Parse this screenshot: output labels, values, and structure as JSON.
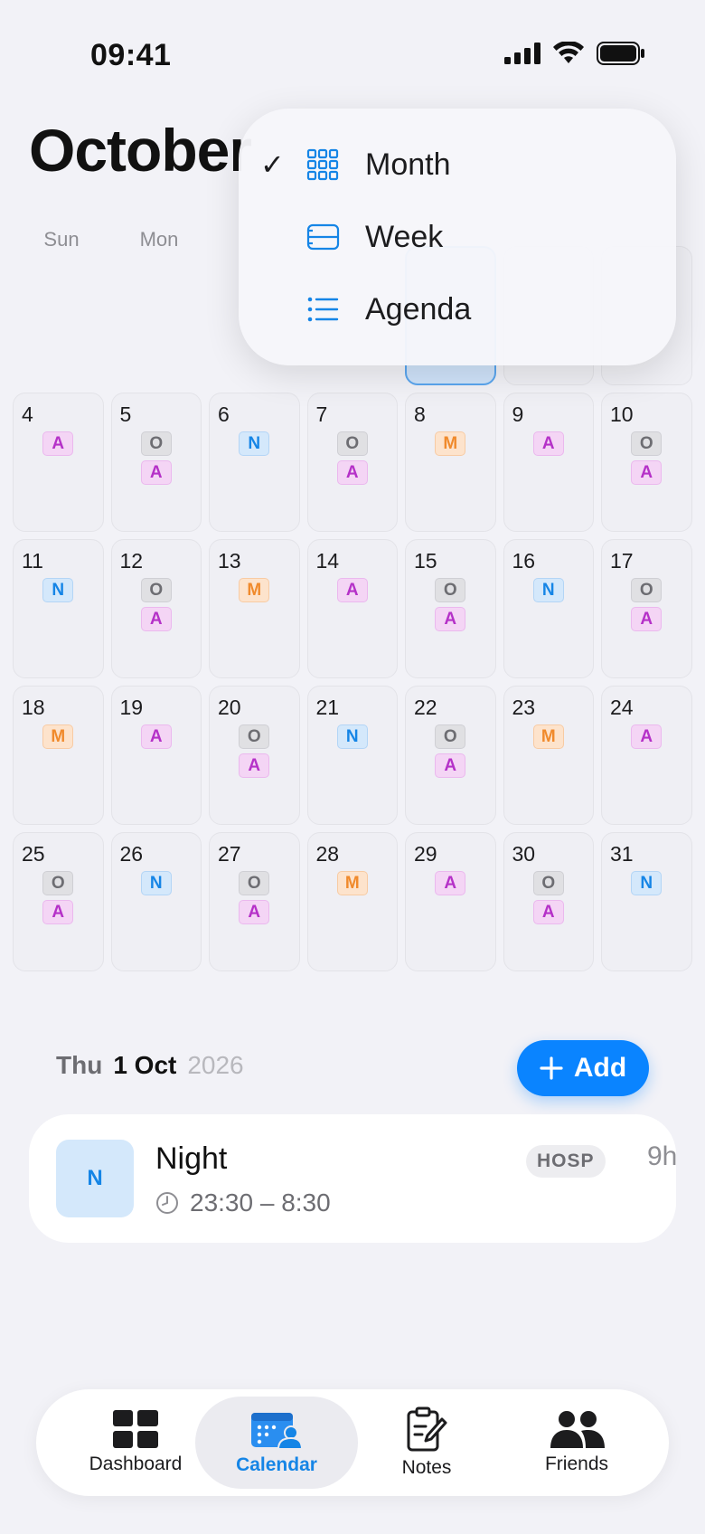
{
  "status": {
    "time": "09:41"
  },
  "header": {
    "title": "October"
  },
  "weekdays": [
    "Sun",
    "Mon"
  ],
  "menu": {
    "items": [
      {
        "label": "Month",
        "checked": true,
        "icon": "grid-icon"
      },
      {
        "label": "Week",
        "checked": false,
        "icon": "week-icon"
      },
      {
        "label": "Agenda",
        "checked": false,
        "icon": "list-icon"
      }
    ],
    "check": "✓"
  },
  "calendar": {
    "weeks": [
      [
        {
          "day": "4",
          "shifts": [
            "A"
          ]
        },
        {
          "day": "5",
          "shifts": [
            "O",
            "A"
          ]
        },
        {
          "day": "6",
          "shifts": [
            "N"
          ]
        },
        {
          "day": "7",
          "shifts": [
            "O",
            "A"
          ]
        },
        {
          "day": "8",
          "shifts": [
            "M"
          ]
        },
        {
          "day": "9",
          "shifts": [
            "A"
          ]
        },
        {
          "day": "10",
          "shifts": [
            "O",
            "A"
          ]
        }
      ],
      [
        {
          "day": "11",
          "shifts": [
            "N"
          ]
        },
        {
          "day": "12",
          "shifts": [
            "O",
            "A"
          ]
        },
        {
          "day": "13",
          "shifts": [
            "M"
          ]
        },
        {
          "day": "14",
          "shifts": [
            "A"
          ]
        },
        {
          "day": "15",
          "shifts": [
            "O",
            "A"
          ]
        },
        {
          "day": "16",
          "shifts": [
            "N"
          ]
        },
        {
          "day": "17",
          "shifts": [
            "O",
            "A"
          ]
        }
      ],
      [
        {
          "day": "18",
          "shifts": [
            "M"
          ]
        },
        {
          "day": "19",
          "shifts": [
            "A"
          ]
        },
        {
          "day": "20",
          "shifts": [
            "O",
            "A"
          ]
        },
        {
          "day": "21",
          "shifts": [
            "N"
          ]
        },
        {
          "day": "22",
          "shifts": [
            "O",
            "A"
          ]
        },
        {
          "day": "23",
          "shifts": [
            "M"
          ]
        },
        {
          "day": "24",
          "shifts": [
            "A"
          ]
        }
      ],
      [
        {
          "day": "25",
          "shifts": [
            "O",
            "A"
          ]
        },
        {
          "day": "26",
          "shifts": [
            "N"
          ]
        },
        {
          "day": "27",
          "shifts": [
            "O",
            "A"
          ]
        },
        {
          "day": "28",
          "shifts": [
            "M"
          ]
        },
        {
          "day": "29",
          "shifts": [
            "A"
          ]
        },
        {
          "day": "30",
          "shifts": [
            "O",
            "A"
          ]
        },
        {
          "day": "31",
          "shifts": [
            "N"
          ]
        }
      ]
    ],
    "colors": {
      "O": "#6d6d72",
      "A": "#b531c8",
      "N": "#1585e6",
      "M": "#f08a2c"
    }
  },
  "selected_day": {
    "weekday": "Thu",
    "day_month": "1 Oct",
    "year": "2026"
  },
  "add_button": {
    "label": "Add"
  },
  "shift": {
    "code": "N",
    "name": "Night",
    "time": "23:30 – 8:30",
    "tag": "HOSP",
    "duration": "9h"
  },
  "tabs": [
    {
      "label": "Dashboard",
      "icon": "dashboard-icon",
      "active": false
    },
    {
      "label": "Calendar",
      "icon": "calendar-person-icon",
      "active": true
    },
    {
      "label": "Notes",
      "icon": "notes-icon",
      "active": false
    },
    {
      "label": "Friends",
      "icon": "friends-icon",
      "active": false
    }
  ],
  "accent": "#0a84ff"
}
